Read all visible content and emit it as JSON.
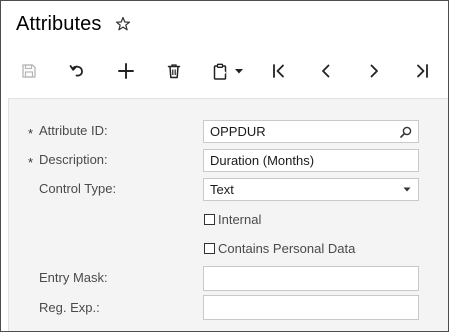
{
  "header": {
    "title": "Attributes",
    "favorite_icon": "star-outline-icon"
  },
  "toolbar": {
    "buttons": [
      {
        "name": "save",
        "icon": "save-icon",
        "enabled": false
      },
      {
        "name": "undo",
        "icon": "undo-icon",
        "enabled": true
      },
      {
        "name": "add",
        "icon": "plus-icon",
        "enabled": true
      },
      {
        "name": "delete",
        "icon": "trash-icon",
        "enabled": true
      },
      {
        "name": "copy-paste",
        "icon": "clipboard-dropdown-icon",
        "enabled": true
      },
      {
        "name": "first",
        "icon": "first-record-icon",
        "enabled": true
      },
      {
        "name": "previous",
        "icon": "chevron-left-icon",
        "enabled": true
      },
      {
        "name": "next",
        "icon": "chevron-right-icon",
        "enabled": true
      },
      {
        "name": "last",
        "icon": "last-record-icon",
        "enabled": true
      }
    ]
  },
  "form": {
    "required_marker": "*",
    "attribute_id": {
      "label": "Attribute ID:",
      "value": "OPPDUR",
      "required": true
    },
    "description": {
      "label": "Description:",
      "value": "Duration (Months)",
      "required": true
    },
    "control_type": {
      "label": "Control Type:",
      "value": "Text"
    },
    "internal": {
      "label": "Internal",
      "checked": false
    },
    "contains_personal_data": {
      "label": "Contains Personal Data",
      "checked": false
    },
    "entry_mask": {
      "label": "Entry Mask:",
      "value": ""
    },
    "reg_exp": {
      "label": "Reg. Exp.:",
      "value": ""
    }
  },
  "colors": {
    "panel_background": "#f4f4f4",
    "field_border": "#c9c9c9",
    "disabled_icon": "#b5b5b5",
    "icon": "#222222"
  }
}
